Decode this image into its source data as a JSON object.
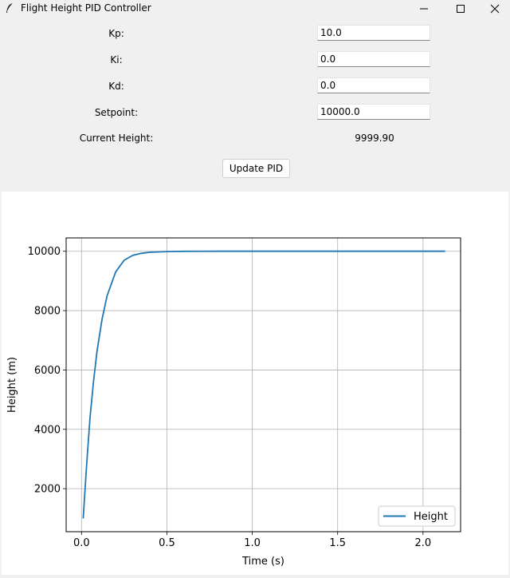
{
  "window": {
    "title": "Flight Height PID Controller"
  },
  "form": {
    "kp": {
      "label": "Kp:",
      "value": "10.0"
    },
    "ki": {
      "label": "Ki:",
      "value": "0.0"
    },
    "kd": {
      "label": "Kd:",
      "value": "0.0"
    },
    "setpoint": {
      "label": "Setpoint:",
      "value": "10000.0"
    },
    "current_height": {
      "label": "Current Height:",
      "value": "9999.90"
    },
    "update_button": "Update PID"
  },
  "chart_data": {
    "type": "line",
    "xlabel": "Time (s)",
    "ylabel": "Height (m)",
    "xlim": [
      -0.09,
      2.22
    ],
    "ylim": [
      550,
      10450
    ],
    "xticks": [
      0.0,
      0.5,
      1.0,
      1.5,
      2.0
    ],
    "xtick_labels": [
      "0.0",
      "0.5",
      "1.0",
      "1.5",
      "2.0"
    ],
    "yticks": [
      2000,
      4000,
      6000,
      8000,
      10000
    ],
    "ytick_labels": [
      "2000",
      "4000",
      "6000",
      "8000",
      "10000"
    ],
    "grid": true,
    "legend": "lower right",
    "series": [
      {
        "name": "Height",
        "color": "#1f77b4",
        "x": [
          0.01,
          0.03,
          0.05,
          0.07,
          0.09,
          0.12,
          0.15,
          0.2,
          0.25,
          0.3,
          0.35,
          0.4,
          0.5,
          0.6,
          0.8,
          1.0,
          1.5,
          2.0,
          2.13
        ],
        "y": [
          1000,
          2800,
          4400,
          5600,
          6600,
          7700,
          8500,
          9300,
          9700,
          9860,
          9930,
          9965,
          9990,
          9997,
          10000,
          10000,
          10000,
          10000,
          10000
        ]
      }
    ]
  }
}
